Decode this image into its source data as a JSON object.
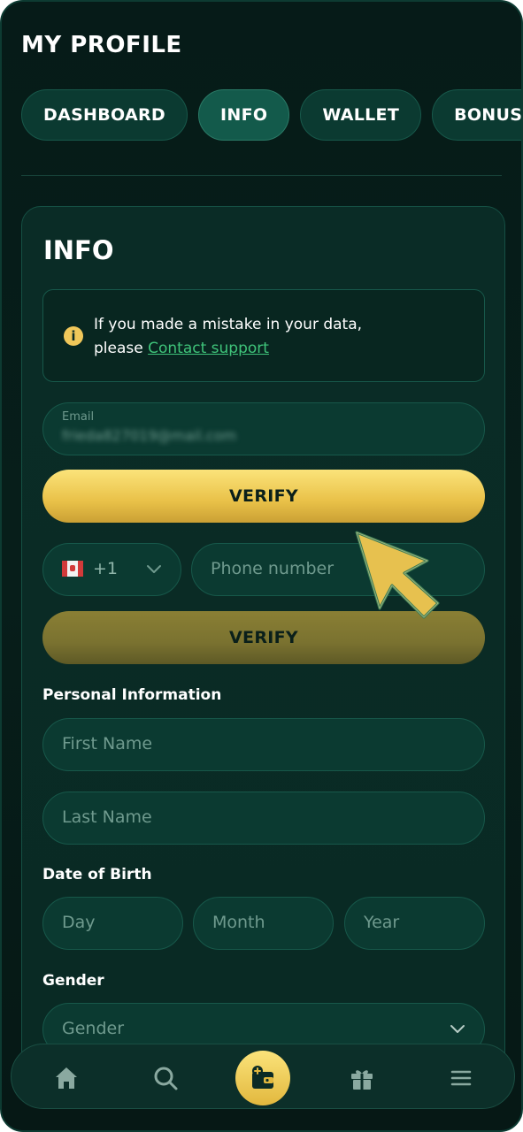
{
  "page": {
    "title": "MY PROFILE"
  },
  "tabs": [
    {
      "label": "DASHBOARD",
      "active": false
    },
    {
      "label": "INFO",
      "active": true
    },
    {
      "label": "WALLET",
      "active": false
    },
    {
      "label": "BONUSES",
      "active": false
    }
  ],
  "card": {
    "title": "INFO"
  },
  "notice": {
    "icon": "info-icon",
    "text_line1": "If you made a mistake in your data,",
    "text_line2_prefix": "please ",
    "link_label": "Contact support"
  },
  "email": {
    "label": "Email",
    "value": "frieda827019@mail.com"
  },
  "verify_email": {
    "label": "VERIFY"
  },
  "phone": {
    "country_code": "+1",
    "flag": "canada-flag-icon",
    "placeholder": "Phone number"
  },
  "verify_phone": {
    "label": "VERIFY"
  },
  "personal": {
    "section_label": "Personal Information",
    "first_name_placeholder": "First Name",
    "last_name_placeholder": "Last Name"
  },
  "dob": {
    "section_label": "Date of Birth",
    "day_placeholder": "Day",
    "month_placeholder": "Month",
    "year_placeholder": "Year"
  },
  "gender": {
    "section_label": "Gender",
    "placeholder": "Gender"
  },
  "nav": {
    "items": [
      "home-icon",
      "search-icon",
      "wallet-icon",
      "gift-icon",
      "menu-icon"
    ]
  },
  "colors": {
    "background": "#061b18",
    "field": "#0b3a31",
    "accent_gold": "#e9c148",
    "link_green": "#3fc47a"
  }
}
